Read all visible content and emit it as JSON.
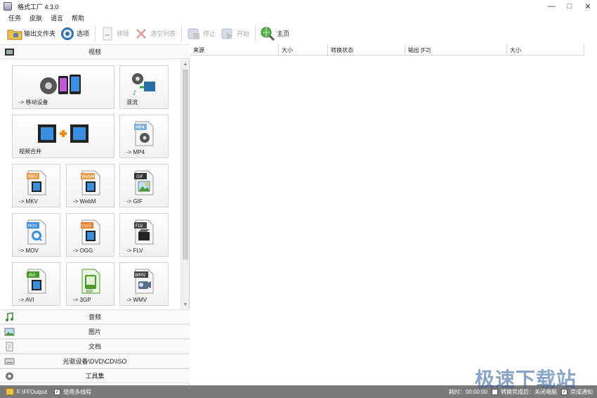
{
  "window": {
    "title": "格式工厂 4.3.0",
    "controls": [
      "—",
      "□",
      "✕"
    ]
  },
  "menu": [
    "任务",
    "皮肤",
    "语言",
    "帮助"
  ],
  "toolbar": {
    "output_folder": "输出文件夹",
    "options": "选项",
    "remove": "移除",
    "clear_list": "清空列表",
    "stop": "停止",
    "start": "开始",
    "home": "主页"
  },
  "categories": {
    "video": "视频",
    "audio": "音频",
    "image": "图片",
    "document": "文档",
    "optical": "光驱设备\\DVD\\CD\\ISO",
    "tools": "工具集"
  },
  "tiles": [
    {
      "label": "-> 移动设备",
      "icon": "mobile-device-icon"
    },
    {
      "label": "混流",
      "icon": "mux-icon"
    },
    {
      "label": "视频合并",
      "icon": "video-merge-icon"
    },
    {
      "label": "-> MP4",
      "icon": "mp4-file-icon",
      "badge": "MP4"
    },
    {
      "label": "-> MKV",
      "icon": "mkv-file-icon",
      "badge": "MKV"
    },
    {
      "label": "-> WebM",
      "icon": "webm-file-icon",
      "badge": "WebM"
    },
    {
      "label": "-> GIF",
      "icon": "gif-file-icon",
      "badge": "GIF"
    },
    {
      "label": "-> MOV",
      "icon": "mov-file-icon",
      "badge": "MOV"
    },
    {
      "label": "-> OGG",
      "icon": "ogg-file-icon",
      "badge": "OGG"
    },
    {
      "label": "-> FLV",
      "icon": "flv-file-icon",
      "badge": "FLV"
    },
    {
      "label": "-> AVI",
      "icon": "avi-file-icon",
      "badge": "AVI"
    },
    {
      "label": "-> 3GP",
      "icon": "3gp-file-icon",
      "badge": "3GP"
    },
    {
      "label": "-> WMV",
      "icon": "wmv-file-icon",
      "badge": "WMV"
    }
  ],
  "table": {
    "columns": [
      "来源",
      "大小",
      "转换状态",
      "输出 [F2]",
      "大小"
    ]
  },
  "status": {
    "output_path": "F:\\FFOutput",
    "multithread": "使用多线程",
    "elapsed_label": "耗时：00:00:00",
    "after_convert": "转换完成后：关闭电脑",
    "notify": "完成通知"
  },
  "watermark": "极速下载站",
  "colors": {
    "mp4": "#7fb0d6",
    "mkv": "#e79a4a",
    "webm": "#e79a4a",
    "gif": "#333333",
    "mov": "#3a8fd8",
    "ogg": "#e77f2a",
    "flv": "#444444",
    "avi": "#4c9a2a",
    "3gp": "#4c9a2a",
    "wmv": "#444444"
  }
}
